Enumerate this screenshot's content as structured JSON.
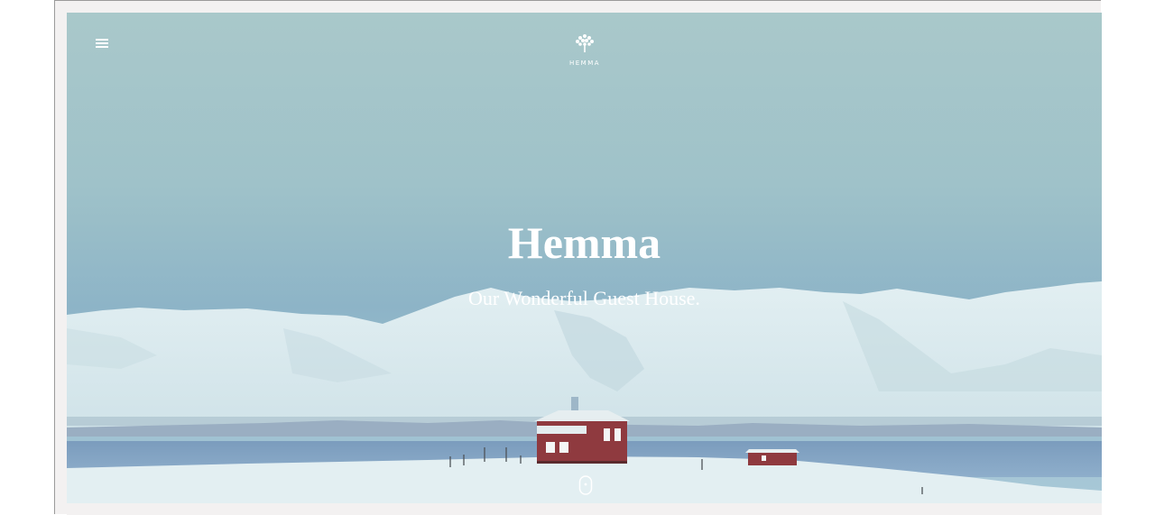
{
  "header": {
    "menu_icon": "hamburger-menu-icon",
    "logo_icon": "tree-icon",
    "logo_text": "HEMMA"
  },
  "hero": {
    "title": "Hemma",
    "subtitle": "Our Wonderful Guest House.",
    "scroll_icon": "mouse-scroll-icon"
  },
  "colors": {
    "sky_top": "#a7c6c9",
    "sky_mid": "#8fb6c6",
    "mountain": "#d9e9ec",
    "water": "#7f9fbe",
    "snow": "#e6f1f3",
    "house": "#8f3a3f",
    "text": "#ffffff"
  }
}
